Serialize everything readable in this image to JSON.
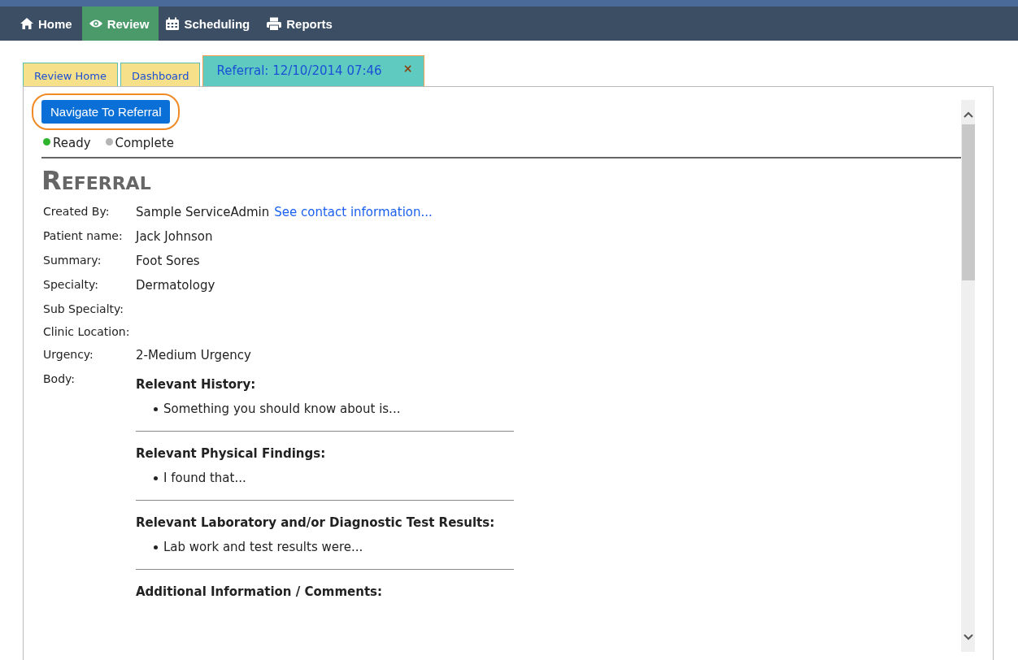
{
  "nav": [
    {
      "label": "Home",
      "kind": "home",
      "selected": false
    },
    {
      "label": "Review",
      "kind": "eye",
      "selected": true
    },
    {
      "label": "Scheduling",
      "kind": "calendar",
      "selected": false
    },
    {
      "label": "Reports",
      "kind": "printer",
      "selected": false
    }
  ],
  "tabs": [
    {
      "label": "Review Home",
      "selected": false
    },
    {
      "label": "Dashboard",
      "selected": false
    },
    {
      "label": "Referral: 12/10/2014 07:46",
      "selected": true,
      "close": "×"
    }
  ],
  "navigate_button": {
    "label": "Navigate To Referral",
    "highlighted": true
  },
  "statuses": [
    {
      "label": "Ready",
      "color": "#2db52d"
    },
    {
      "label": "Complete",
      "color": "#b4b4b4"
    }
  ],
  "title": "Referral",
  "fields": [
    {
      "label": "Created By:",
      "value": "Sample ServiceAdmin",
      "link": "See contact information..."
    },
    {
      "label": "Patient name:",
      "value": "Jack Johnson"
    },
    {
      "label": "Summary:",
      "value": "Foot Sores"
    },
    {
      "label": "Specialty:",
      "value": "Dermatology"
    },
    {
      "label": "Sub Specialty:"
    },
    {
      "label": "Clinic Location:"
    },
    {
      "label": "Urgency:",
      "value": "2-Medium Urgency"
    }
  ],
  "body": {
    "label": "Body:",
    "sections": [
      {
        "heading": "Relevant History:",
        "items": [
          "Something you should know about is..."
        ]
      },
      {
        "heading": "Relevant Physical Findings:",
        "items": [
          "I found that..."
        ]
      },
      {
        "heading": "Relevant Laboratory and/or Diagnostic Test Results:",
        "items": [
          "Lab work and test results were..."
        ]
      },
      {
        "heading": "Additional Information / Comments:"
      }
    ]
  }
}
